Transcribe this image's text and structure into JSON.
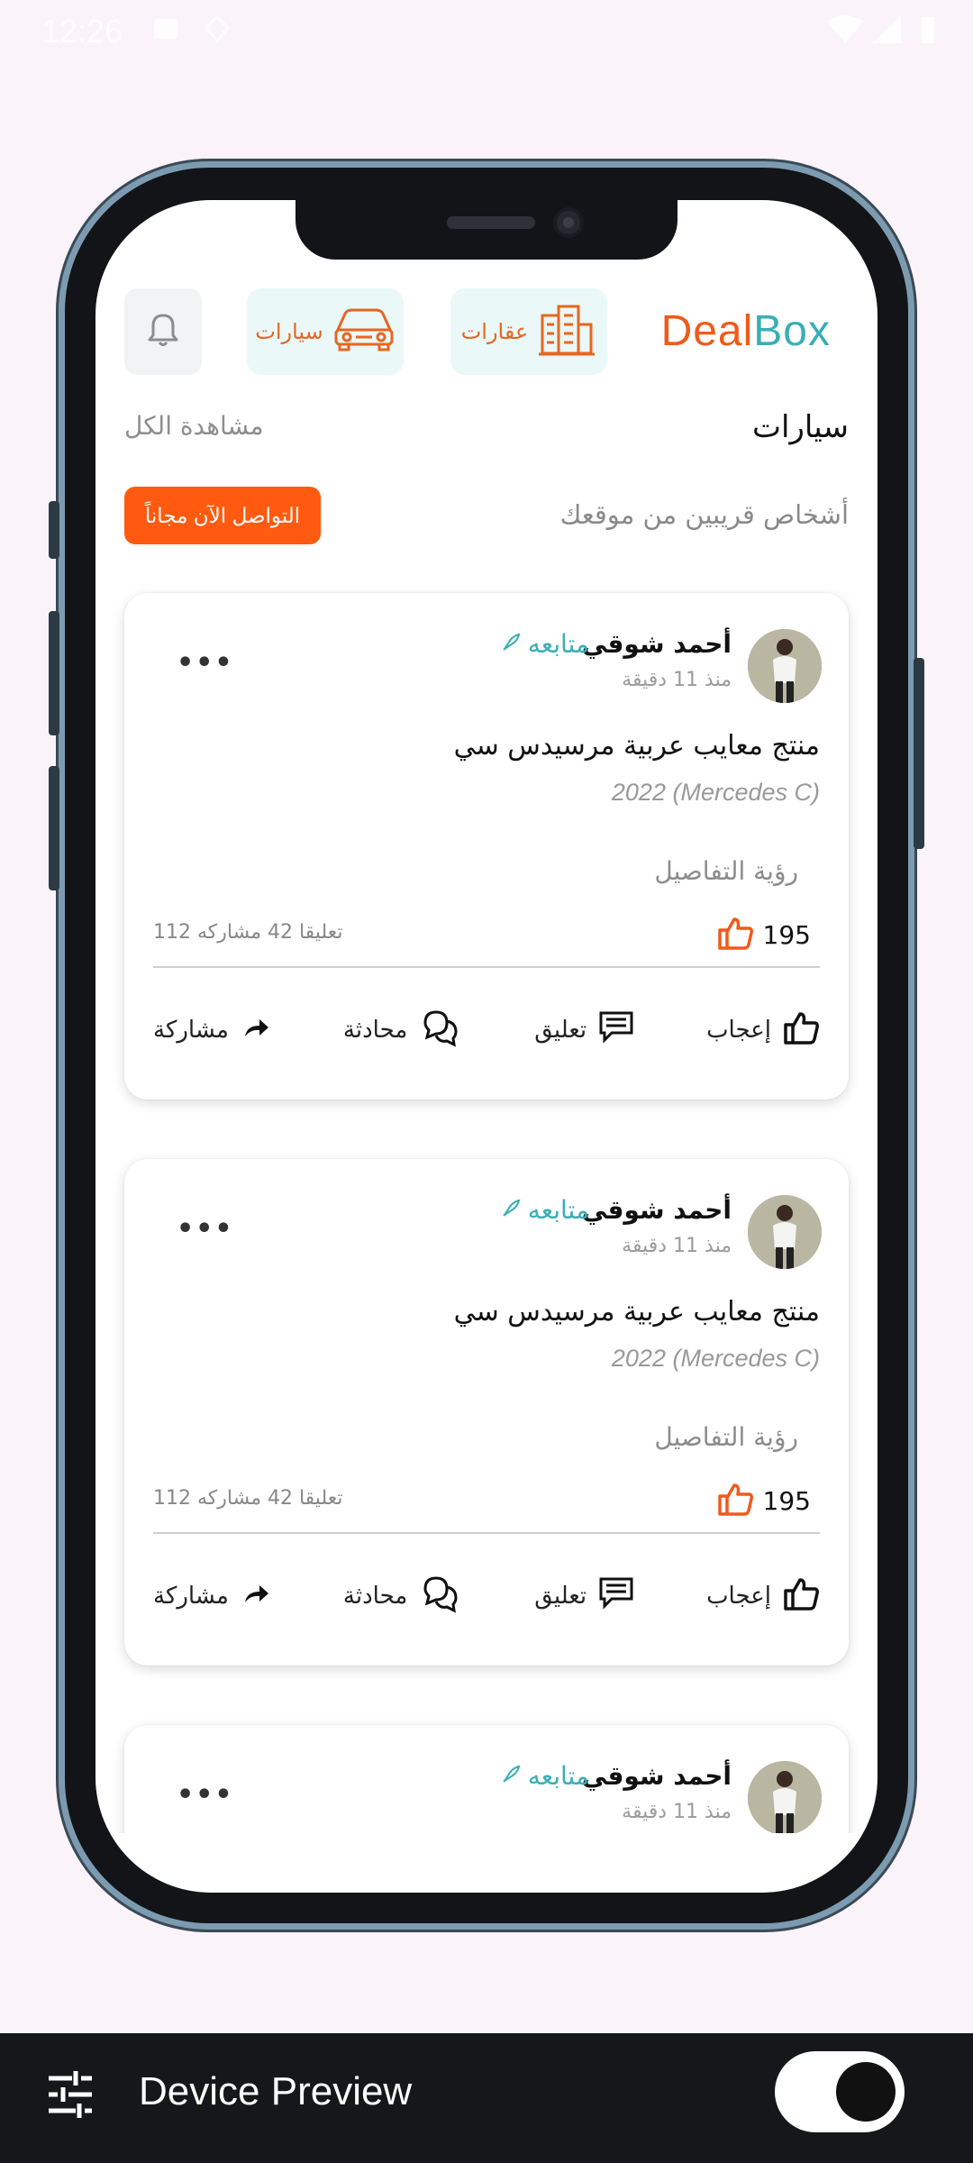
{
  "status_bar": {
    "time": "12:26"
  },
  "header": {
    "logo_part1": "Deal",
    "logo_part2": "Box",
    "chip_realestate": "عقارات",
    "chip_cars": "سيارات"
  },
  "section": {
    "title": "سيارات",
    "see_all": "مشاهدة الكل",
    "nearby": "أشخاص قريبين من موقعك",
    "cta": "التواصل الآن مجاناً"
  },
  "posts": [
    {
      "author": "أحمد شوقي",
      "time": "منذ 11 دقيقة",
      "follow": "متابعه",
      "title": "منتج معايب عربية مرسيدس سي",
      "subtitle": "2022 (Mercedes C)",
      "details": "رؤية التفاصيل",
      "likes": "195",
      "stats": "112 تعليقا  42 مشاركه",
      "actions": {
        "like": "إعجاب",
        "comment": "تعليق",
        "chat": "محادثة",
        "share": "مشاركة"
      }
    },
    {
      "author": "أحمد شوقي",
      "time": "منذ 11 دقيقة",
      "follow": "متابعه",
      "title": "منتج معايب عربية مرسيدس سي",
      "subtitle": "2022 (Mercedes C)",
      "details": "رؤية التفاصيل",
      "likes": "195",
      "stats": "112 تعليقا  42 مشاركه",
      "actions": {
        "like": "إعجاب",
        "comment": "تعليق",
        "chat": "محادثة",
        "share": "مشاركة"
      }
    },
    {
      "author": "أحمد شوقي",
      "time": "منذ 11 دقيقة",
      "follow": "متابعه"
    }
  ],
  "device_preview": {
    "title": "Device Preview",
    "enabled": true
  },
  "colors": {
    "brand_orange": "#f05a1a",
    "brand_teal": "#3aaeb6",
    "cta": "#ff5a0f"
  },
  "icons": [
    "bell-icon",
    "car-icon",
    "buildings-icon",
    "rocket-icon",
    "thumbs-up-icon",
    "comment-icon",
    "chat-icon",
    "share-icon",
    "more-icon",
    "sliders-icon"
  ]
}
